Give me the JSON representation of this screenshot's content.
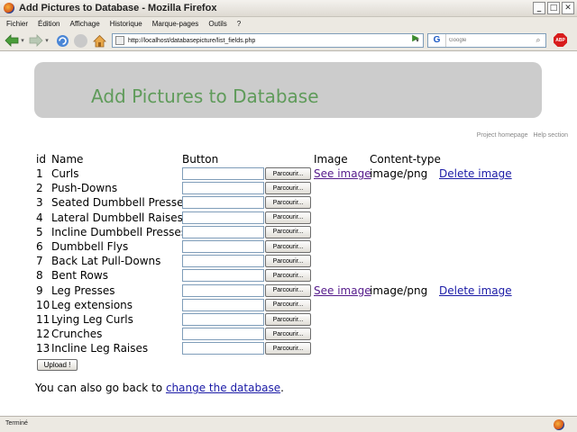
{
  "window": {
    "title": "Add Pictures to Database - Mozilla Firefox",
    "buttons": [
      "_",
      "□",
      "✕"
    ]
  },
  "menu": [
    "Fichier",
    "Édition",
    "Affichage",
    "Historique",
    "Marque-pages",
    "Outils",
    "?"
  ],
  "nav": {
    "url": "http://localhost/databasepicture/list_fields.php",
    "search_placeholder": "Google"
  },
  "page": {
    "heading": "Add Pictures to Database",
    "links": [
      "Project homepage",
      "Help section"
    ],
    "headers": {
      "id": "id",
      "name": "Name",
      "button": "Button",
      "image": "Image",
      "content_type": "Content-type"
    },
    "browse_label": "Parcourir...",
    "rows": [
      {
        "id": "1",
        "name": "Curls",
        "image": "See image",
        "type": "image/png",
        "delete": "Delete image"
      },
      {
        "id": "2",
        "name": "Push-Downs"
      },
      {
        "id": "3",
        "name": "Seated Dumbbell Presses"
      },
      {
        "id": "4",
        "name": "Lateral Dumbbell Raises"
      },
      {
        "id": "5",
        "name": "Incline Dumbbell Presses"
      },
      {
        "id": "6",
        "name": "Dumbbell Flys"
      },
      {
        "id": "7",
        "name": "Back Lat Pull-Downs"
      },
      {
        "id": "8",
        "name": "Bent Rows"
      },
      {
        "id": "9",
        "name": "Leg Presses",
        "image": "See image",
        "type": "image/png",
        "delete": "Delete image"
      },
      {
        "id": "10",
        "name": "Leg extensions"
      },
      {
        "id": "11",
        "name": "Lying Leg Curls"
      },
      {
        "id": "12",
        "name": "Crunches"
      },
      {
        "id": "13",
        "name": "Incline Leg Raises"
      }
    ],
    "upload_label": "Upload !",
    "back_text": "You can also go back to",
    "back_link": "change the database",
    "back_end": "."
  },
  "status": "Terminé"
}
